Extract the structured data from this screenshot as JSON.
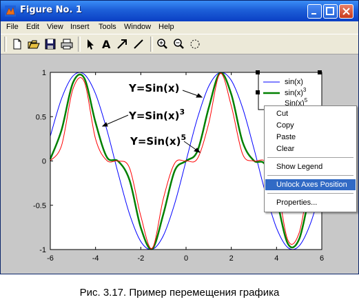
{
  "window": {
    "title": "Figure No. 1"
  },
  "menubar": [
    "File",
    "Edit",
    "View",
    "Insert",
    "Tools",
    "Window",
    "Help"
  ],
  "toolbar_icons": [
    "new-file-icon",
    "open-folder-icon",
    "save-icon",
    "print-icon",
    "select-arrow-icon",
    "text-icon",
    "arrow-icon",
    "line-icon",
    "zoom-in-icon",
    "zoom-out-icon",
    "rotate-icon"
  ],
  "chart_data": {
    "type": "line",
    "x": [
      -6,
      -5.5,
      -5,
      -4.5,
      -4,
      -3.5,
      -3,
      -2.5,
      -2,
      -1.5,
      -1,
      -0.5,
      0,
      0.5,
      1,
      1.5,
      2,
      2.5,
      3,
      3.5,
      4,
      4.5,
      5,
      5.5,
      6
    ],
    "xlim": [
      -6,
      6
    ],
    "ylim": [
      -1,
      1
    ],
    "xticks": [
      "-6",
      "-4",
      "-2",
      "0",
      "2",
      "4",
      "6"
    ],
    "yticks": [
      "1",
      "0.5",
      "0",
      "-0.5",
      "-1"
    ],
    "series": [
      {
        "name": "sin(x)",
        "color": "#0000ff",
        "width": 1,
        "values": [
          0.279,
          0.706,
          0.959,
          0.978,
          0.757,
          0.351,
          -0.141,
          -0.598,
          -0.909,
          -0.997,
          -0.841,
          -0.479,
          0,
          0.479,
          0.841,
          0.997,
          0.909,
          0.598,
          0.141,
          -0.351,
          -0.757,
          -0.978,
          -0.959,
          -0.706,
          -0.279
        ]
      },
      {
        "name": "sin(x)^3",
        "color": "#008000",
        "width": 2.5,
        "values": [
          0.022,
          0.352,
          0.882,
          0.935,
          0.433,
          0.043,
          -0.003,
          -0.214,
          -0.752,
          -0.992,
          -0.596,
          -0.11,
          0,
          0.11,
          0.596,
          0.992,
          0.752,
          0.214,
          0.003,
          -0.043,
          -0.433,
          -0.935,
          -0.882,
          -0.352,
          -0.022
        ]
      },
      {
        "name": "sin(x)^5",
        "color": "#ff0000",
        "width": 1,
        "values": [
          0.002,
          0.175,
          0.811,
          0.895,
          0.248,
          0.005,
          0,
          -0.077,
          -0.621,
          -0.987,
          -0.421,
          -0.025,
          0,
          0.025,
          0.421,
          0.987,
          0.621,
          0.077,
          0,
          -0.005,
          -0.248,
          -0.895,
          -0.811,
          -0.175,
          -0.002
        ]
      }
    ],
    "annotations": [
      "Y=Sin(x)",
      "Y=Sin(x)",
      "Y=Sin(x)"
    ],
    "annotation_sups": [
      "",
      "3",
      "5"
    ],
    "legend": {
      "entries": [
        "sin(x)",
        "sin(x)",
        "Sin(x)"
      ],
      "sups": [
        "",
        "3",
        "5"
      ],
      "position": "top-right"
    }
  },
  "context_menu": {
    "items": [
      "Cut",
      "Copy",
      "Paste",
      "Clear",
      "Show Legend",
      "Unlock Axes Position",
      "Properties..."
    ],
    "highlighted": "Unlock Axes Position"
  },
  "caption": "Рис. 3.17. Пример перемещения графика"
}
